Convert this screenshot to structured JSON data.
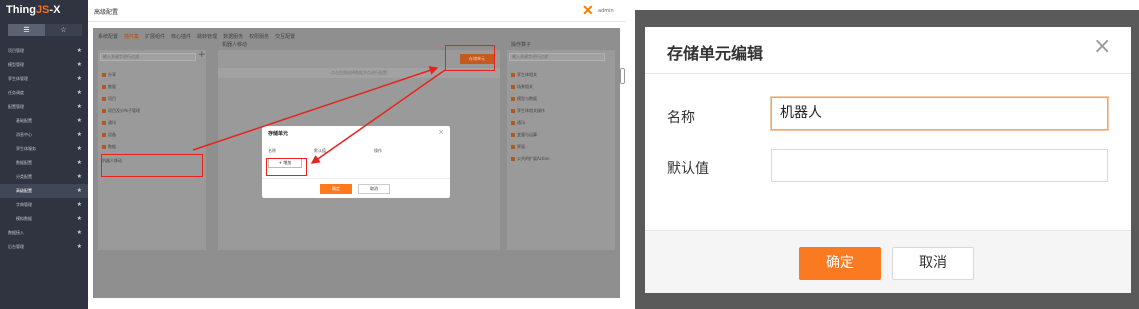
{
  "left": {
    "logo_main": "Thing",
    "logo_accent": "JS",
    "logo_tail": "-X",
    "side_tabs": [
      "☰",
      "☆"
    ],
    "sidebar_items": [
      {
        "label": "项目管理",
        "sub": false,
        "active": false
      },
      {
        "label": "模型管理",
        "sub": false,
        "active": false
      },
      {
        "label": "孪生体管理",
        "sub": false,
        "active": false
      },
      {
        "label": "任务调度",
        "sub": false,
        "active": false
      },
      {
        "label": "配置管理",
        "sub": false,
        "active": false
      },
      {
        "label": "基础配置",
        "sub": true,
        "active": false
      },
      {
        "label": "消息中心",
        "sub": true,
        "active": false
      },
      {
        "label": "孪生体服务",
        "sub": true,
        "active": false
      },
      {
        "label": "数据配置",
        "sub": true,
        "active": false
      },
      {
        "label": "分类配置",
        "sub": true,
        "active": false
      },
      {
        "label": "高级配置",
        "sub": true,
        "active": true
      },
      {
        "label": "字典管理",
        "sub": true,
        "active": false
      },
      {
        "label": "模拟数据",
        "sub": true,
        "active": false
      },
      {
        "label": "数据接入",
        "sub": false,
        "active": false
      },
      {
        "label": "后台管理",
        "sub": false,
        "active": false
      }
    ],
    "top_title": "高级配置",
    "top_user": "admin",
    "config_tabs": [
      "系统配置",
      "插件集",
      "扩展组件",
      "核心插件",
      "跳转管理",
      "数据服务",
      "权限服务",
      "交互配置"
    ],
    "search_placeholder": "输入关键字进行过滤",
    "tree": [
      "分享",
      "数量",
      "项目",
      "项目及分布子管理",
      "通讯",
      "设备",
      "数据"
    ],
    "tree_selected": "机器人移动",
    "mid_title": "机器人移动",
    "mid_bar_text": "点击左侧选择数据节点进行配置",
    "store_button": "存储单元",
    "right_title": "操作算子",
    "right_search": "输入关键字进行过滤",
    "right_tree": [
      "孪生体相关",
      "场景相关",
      "模型与数据",
      "孪生体相关操作",
      "通讯",
      "变量与运算",
      "界面",
      "公共的扩展Action"
    ],
    "small_dialog": {
      "title": "存储单元",
      "col_name": "名称",
      "col_default": "默认值",
      "col_action": "操作",
      "add": "+ 增加",
      "ok": "确定",
      "cancel": "取消"
    }
  },
  "right": {
    "title": "存储单元编辑",
    "close": "×",
    "name_label": "名称",
    "name_value": "机器人",
    "default_label": "默认值",
    "default_value": "",
    "ok": "确定",
    "cancel": "取消"
  },
  "colors": {
    "accent": "#fa7a22",
    "annotation": "#e8231e",
    "sidebar": "#2f3440"
  }
}
